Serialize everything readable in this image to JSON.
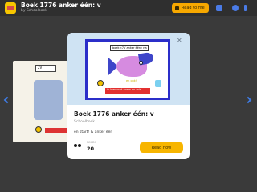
{
  "topbar": {
    "title": "Boek 1776 anker één: v",
    "byline": "by Schoolboek",
    "read_to_me": "Read to me"
  },
  "background": {
    "page_tag": "2V"
  },
  "modal": {
    "title": "Boek 1776 anker één: v",
    "author": "Schoolboek",
    "description": "en start! & anker één",
    "reads_label": "READS",
    "reads_value": "20",
    "read_now": "Read now",
    "illustration": {
      "title_text": "boek «7V anker één» na",
      "yellow_text": "en ook!",
      "red_text": "ik lees met zoem en mie."
    }
  },
  "colors": {
    "accent": "#f7b500",
    "nav_arrow": "#3f7be3",
    "background": "#3a3a3a"
  }
}
